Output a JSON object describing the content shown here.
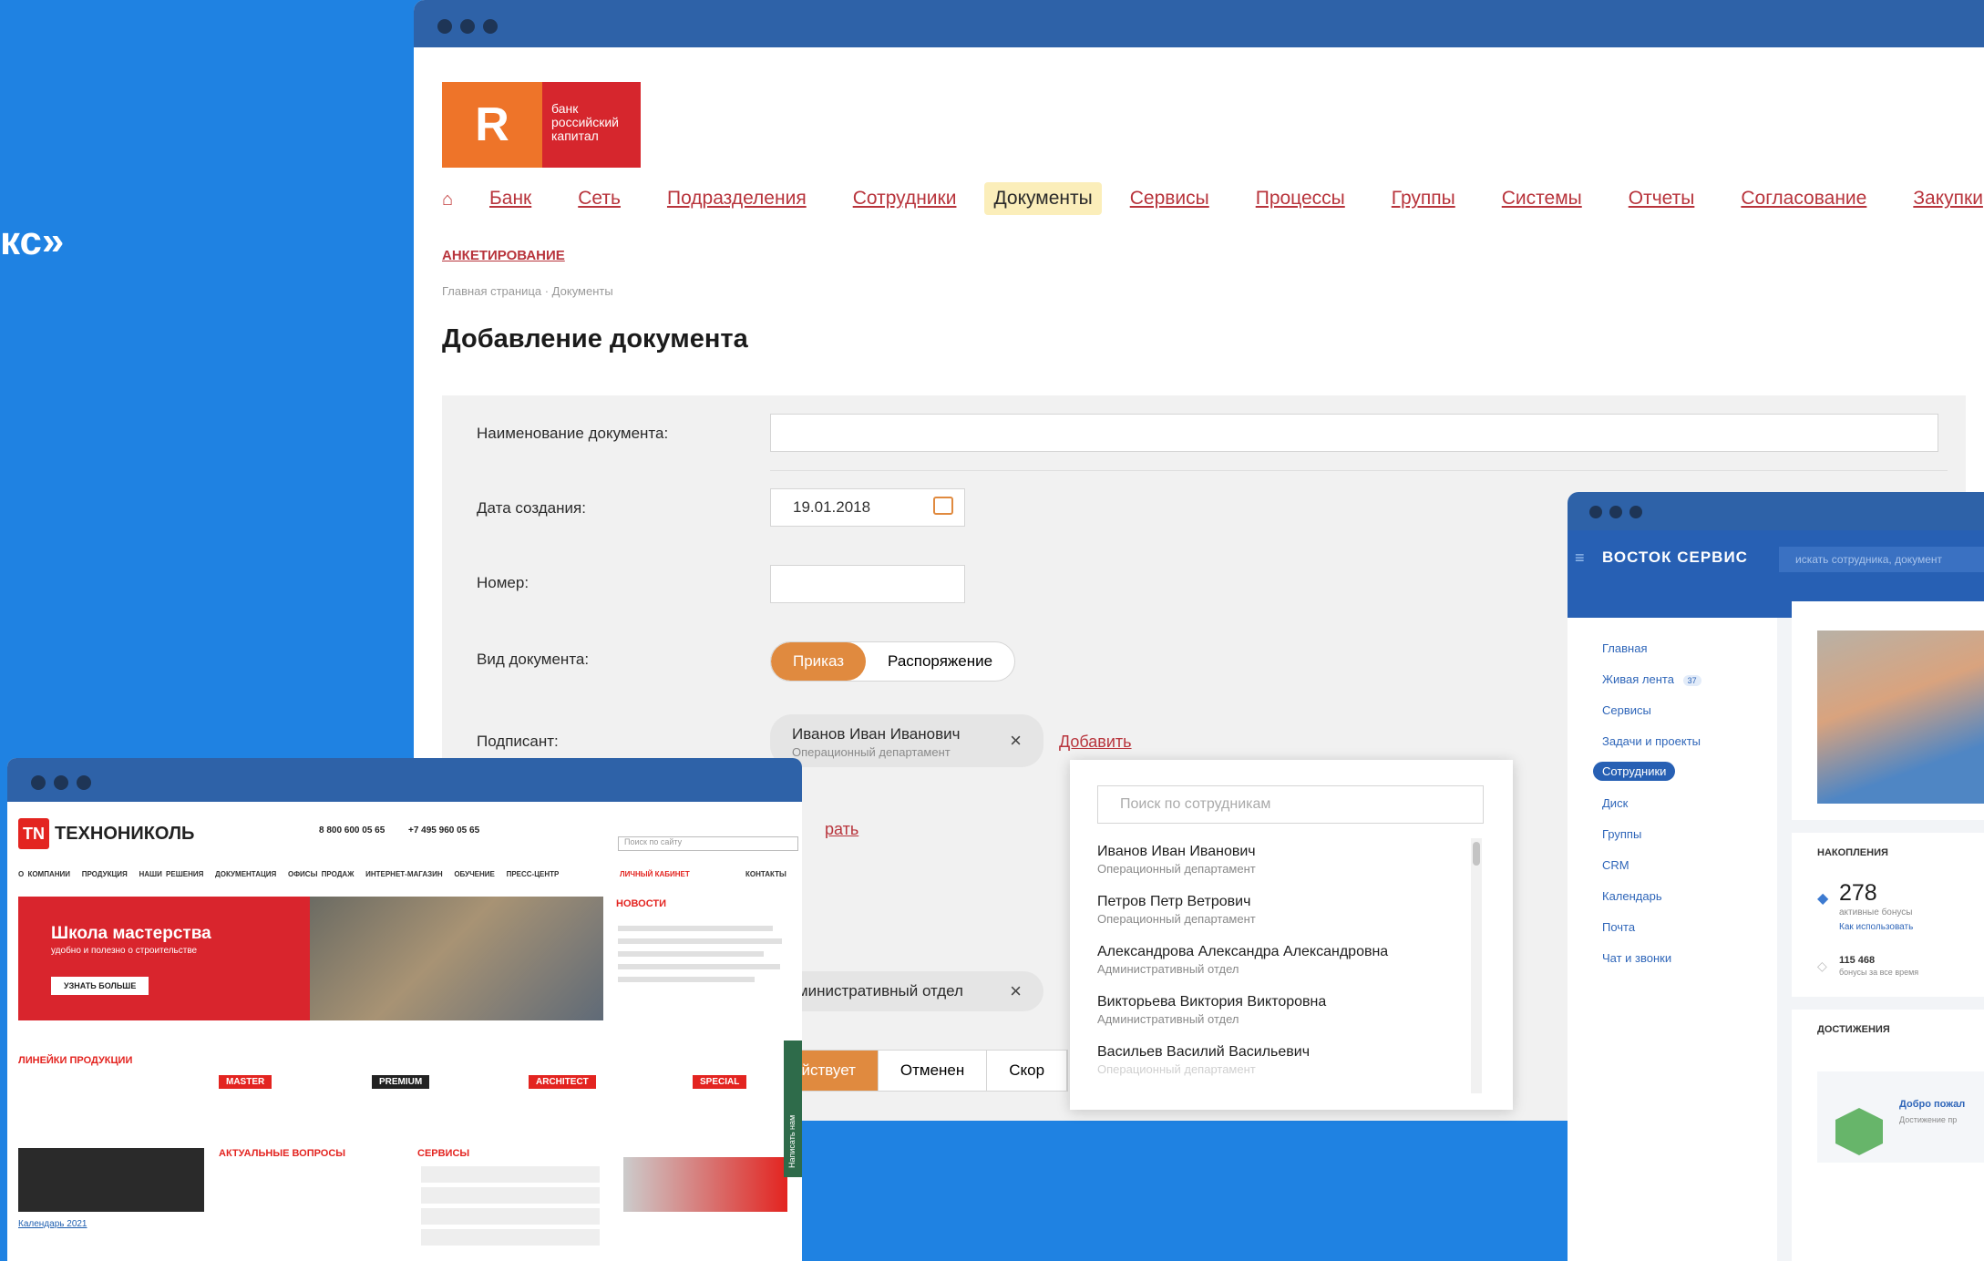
{
  "page_heading_fragment": "кс»",
  "main": {
    "logo": {
      "text_lines": [
        "банк",
        "российский",
        "капитал"
      ]
    },
    "nav": [
      "Банк",
      "Сеть",
      "Подразделения",
      "Сотрудники",
      "Документы",
      "Сервисы",
      "Процессы",
      "Группы",
      "Системы",
      "Отчеты",
      "Согласование",
      "Закупки"
    ],
    "nav_active": "Документы",
    "subnav": "АНКЕТИРОВАНИЕ",
    "breadcrumb": "Главная страница · Документы",
    "title": "Добавление документа",
    "form": {
      "name_label": "Наименование документа:",
      "name_value": "",
      "date_label": "Дата создания:",
      "date_value": "19.01.2018",
      "number_label": "Номер:",
      "number_value": "",
      "type_label": "Вид документа:",
      "type_options": [
        "Приказ",
        "Распоряжение"
      ],
      "signer_label": "Подписант:",
      "signer_name": "Иванов Иван Иванович",
      "signer_dept": "Операционный департамент",
      "add_link": "Добавить",
      "hidden_link_fragment": "рать",
      "dept_chip": "дминистративный отдел",
      "status_options": [
        "ействует",
        "Отменен",
        "Скор"
      ]
    },
    "dropdown": {
      "search_placeholder": "Поиск по сотрудникам",
      "items": [
        {
          "name": "Иванов Иван Иванович",
          "dept": "Операционный департамент"
        },
        {
          "name": "Петров Петр Ветрович",
          "dept": "Операционный департамент"
        },
        {
          "name": "Александрова Александра Александровна",
          "dept": "Административный отдел"
        },
        {
          "name": "Викторьева Виктория Викторовна",
          "dept": "Административный отдел"
        },
        {
          "name": "Васильев Василий Васильевич",
          "dept": "Операционный департамент"
        }
      ]
    }
  },
  "left": {
    "brand": "ТЕХНОНИКОЛЬ",
    "phone1": "8 800 600 05 65",
    "phone2": "+7 495 960 05 65",
    "menu": [
      "О КОМПАНИИ",
      "ПРОДУКЦИЯ",
      "НАШИ РЕШЕНИЯ",
      "ДОКУМЕНТАЦИЯ",
      "ОФИСЫ ПРОДАЖ",
      "ИНТЕРНЕТ-МАГАЗИН",
      "ОБУЧЕНИЕ",
      "ПРЕСС-ЦЕНТР"
    ],
    "cabinet": "ЛИЧНЫЙ КАБИНЕТ",
    "contacts": "КОНТАКТЫ",
    "banner_title": "Школа мастерства",
    "banner_sub": "удобно и полезно о строительстве",
    "banner_btn": "УЗНАТЬ БОЛЬШЕ",
    "news_title": "НОВОСТИ",
    "lines_title": "ЛИНЕЙКИ ПРОДУКЦИИ",
    "lines": [
      "MASTER",
      "PREMIUM",
      "ARCHITECT",
      "SPECIAL"
    ],
    "faq_title": "АКТУАЛЬНЫЕ ВОПРОСЫ",
    "services_title": "СЕРВИСЫ",
    "calendar": "Календарь 2021",
    "side_tab": "Написать нам",
    "search_placeholder": "Поиск по сайту"
  },
  "right": {
    "brand": "ВОСТОК СЕРВИС",
    "search_placeholder": "искать сотрудника, документ",
    "menu": [
      "Главная",
      "Живая лента",
      "Сервисы",
      "Задачи и проекты",
      "Сотрудники",
      "Диск",
      "Группы",
      "CRM",
      "Календарь",
      "Почта",
      "Чат и звонки"
    ],
    "menu_active": "Сотрудники",
    "live_badge": "37",
    "savings_title": "НАКОПЛЕНИЯ",
    "bonus_value": "278",
    "bonus_label": "активные бонусы",
    "bonus_link": "Как использовать",
    "bonus_total": "115 468",
    "bonus_total_label": "бонусы за все время",
    "achievements_title": "ДОСТИЖЕНИЯ",
    "welcome": "Добро пожал",
    "welcome_sub": "Достижение пр"
  }
}
